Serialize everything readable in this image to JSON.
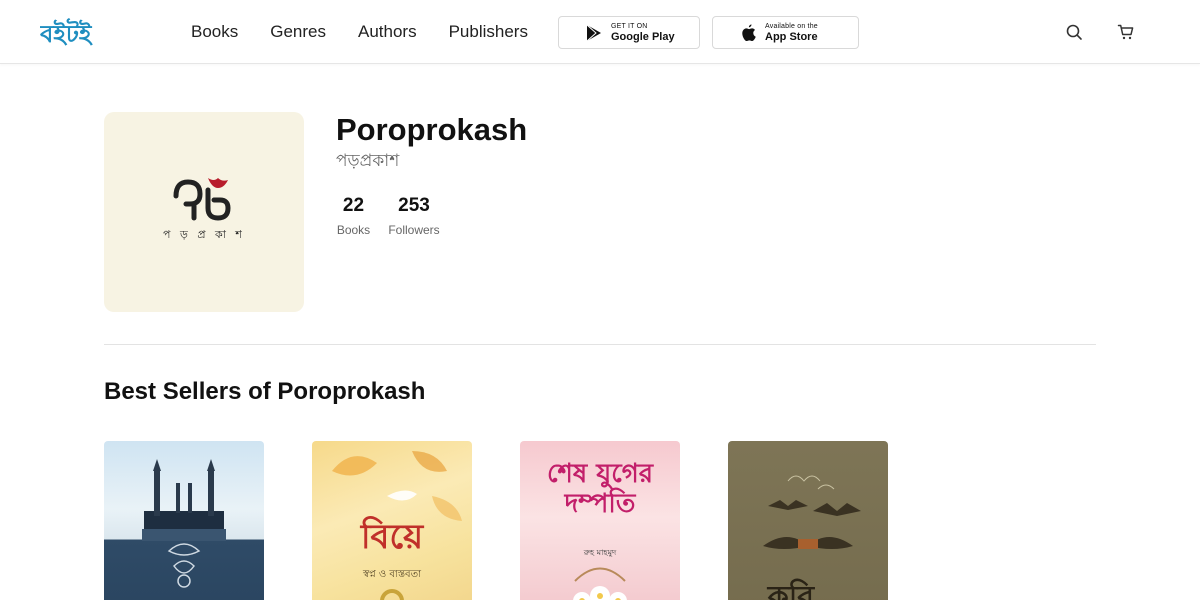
{
  "header": {
    "logo_label": "বইটই",
    "nav": [
      "Books",
      "Genres",
      "Authors",
      "Publishers"
    ],
    "google_play": {
      "small": "GET IT ON",
      "big": "Google Play"
    },
    "app_store": {
      "small": "Available on the",
      "big": "App Store"
    }
  },
  "publisher": {
    "logo_wordmark": "প ড় প্র কা শ",
    "name": "Poroprokash",
    "name_bn": "পড়প্রকাশ",
    "stats": {
      "books_count": "22",
      "books_label": "Books",
      "followers_count": "253",
      "followers_label": "Followers"
    }
  },
  "best_sellers": {
    "title": "Best Sellers of Poroprokash",
    "books": [
      {
        "cover_title": "",
        "cover_subtitle": ""
      },
      {
        "cover_title": "বিয়ে",
        "cover_subtitle": "স্বপ্ন ও বাস্তবতা"
      },
      {
        "cover_title": "শেষ যুগের দম্পতি",
        "cover_subtitle": "রুহ মাহমুদ"
      },
      {
        "cover_title": "কবি...",
        "cover_subtitle": ""
      }
    ]
  },
  "colors": {
    "accent": "#1f8ec0",
    "logo_bg": "#f7f3e3",
    "logo_mark": "#b81c2c"
  }
}
